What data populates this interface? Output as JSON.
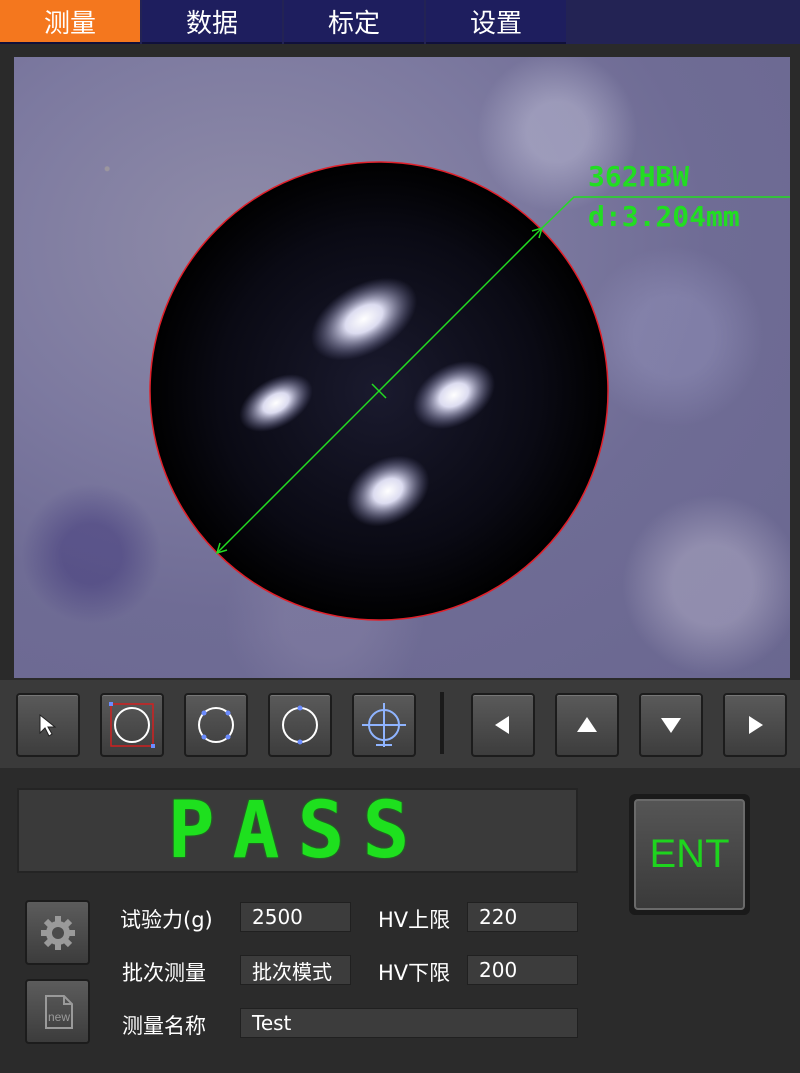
{
  "tabs": [
    "测量",
    "数据",
    "标定",
    "设置"
  ],
  "active_tab": "测量",
  "colors": {
    "active_tab": "#f4771e",
    "tab": "#1e1e5e",
    "measure_line": "#22dd22",
    "circle": "#e0202a",
    "pass": "#1ee01e"
  },
  "measurement": {
    "hardness": "362HBW",
    "diameter": "d:3.204mm"
  },
  "toolbar": {
    "tools": [
      "pointer-icon",
      "circle-select-icon",
      "circle-3point-icon",
      "circle-2point-icon",
      "crosshair-icon"
    ],
    "nav": [
      "arrow-left-icon",
      "arrow-up-icon",
      "arrow-down-icon",
      "arrow-right-icon"
    ]
  },
  "result": {
    "status": "PASS",
    "enter_label": "ENT"
  },
  "form": {
    "test_force_label": "试验力(g)",
    "test_force_value": "2500",
    "hv_upper_label": "HV上限",
    "hv_upper_value": "220",
    "batch_label": "批次测量",
    "batch_value": "批次模式",
    "hv_lower_label": "HV下限",
    "hv_lower_value": "200",
    "name_label": "测量名称",
    "name_value": "Test"
  },
  "side_buttons": {
    "new_label": "new"
  }
}
